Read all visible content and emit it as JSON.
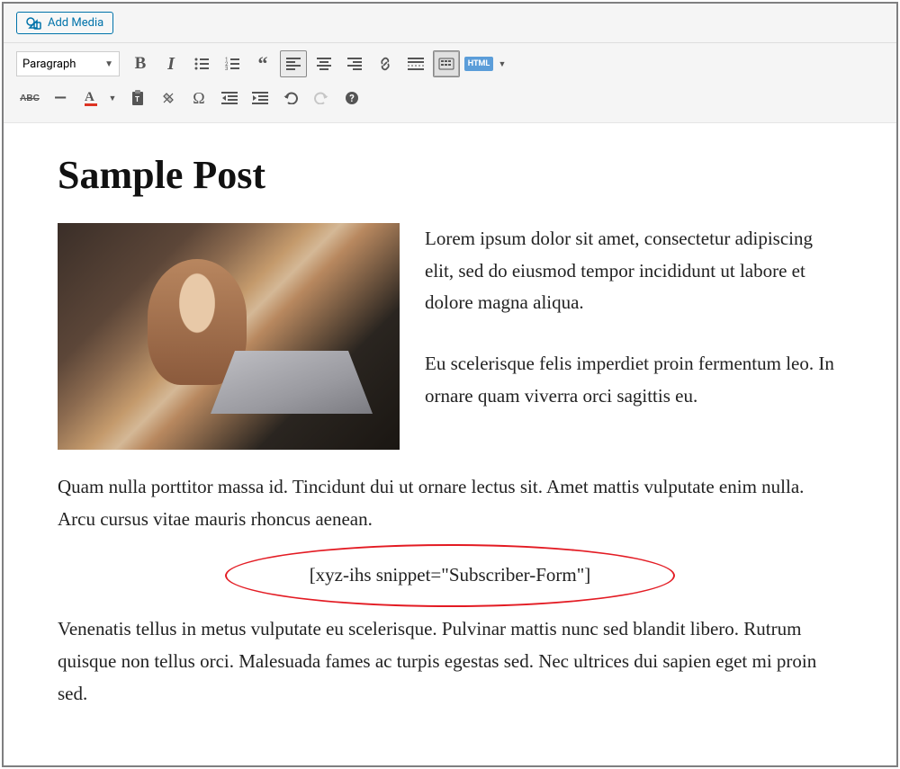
{
  "toolbar": {
    "add_media_label": "Add Media",
    "format_selected": "Paragraph"
  },
  "buttons_row1": {
    "bold": "B",
    "italic": "I",
    "html": "HTML"
  },
  "post": {
    "title": "Sample Post",
    "para1": "Lorem ipsum dolor sit amet, consectetur adipiscing elit, sed do eiusmod tempor incididunt ut labore et dolore magna aliqua.",
    "para2": "Eu scelerisque felis imperdiet proin fermentum leo. In ornare quam viverra orci sagittis eu.",
    "para3": "Quam nulla porttitor massa id. Tincidunt dui ut ornare lectus sit. Amet mattis vulputate enim nulla. Arcu cursus vitae mauris rhoncus aenean.",
    "shortcode": "[xyz-ihs snippet=\"Subscriber-Form\"]",
    "para4": "Venenatis tellus in metus vulputate eu scelerisque. Pulvinar mattis nunc sed blandit libero. Rutrum quisque non tellus orci. Malesuada fames ac turpis egestas sed. Nec ultrices dui sapien eget mi proin sed."
  }
}
